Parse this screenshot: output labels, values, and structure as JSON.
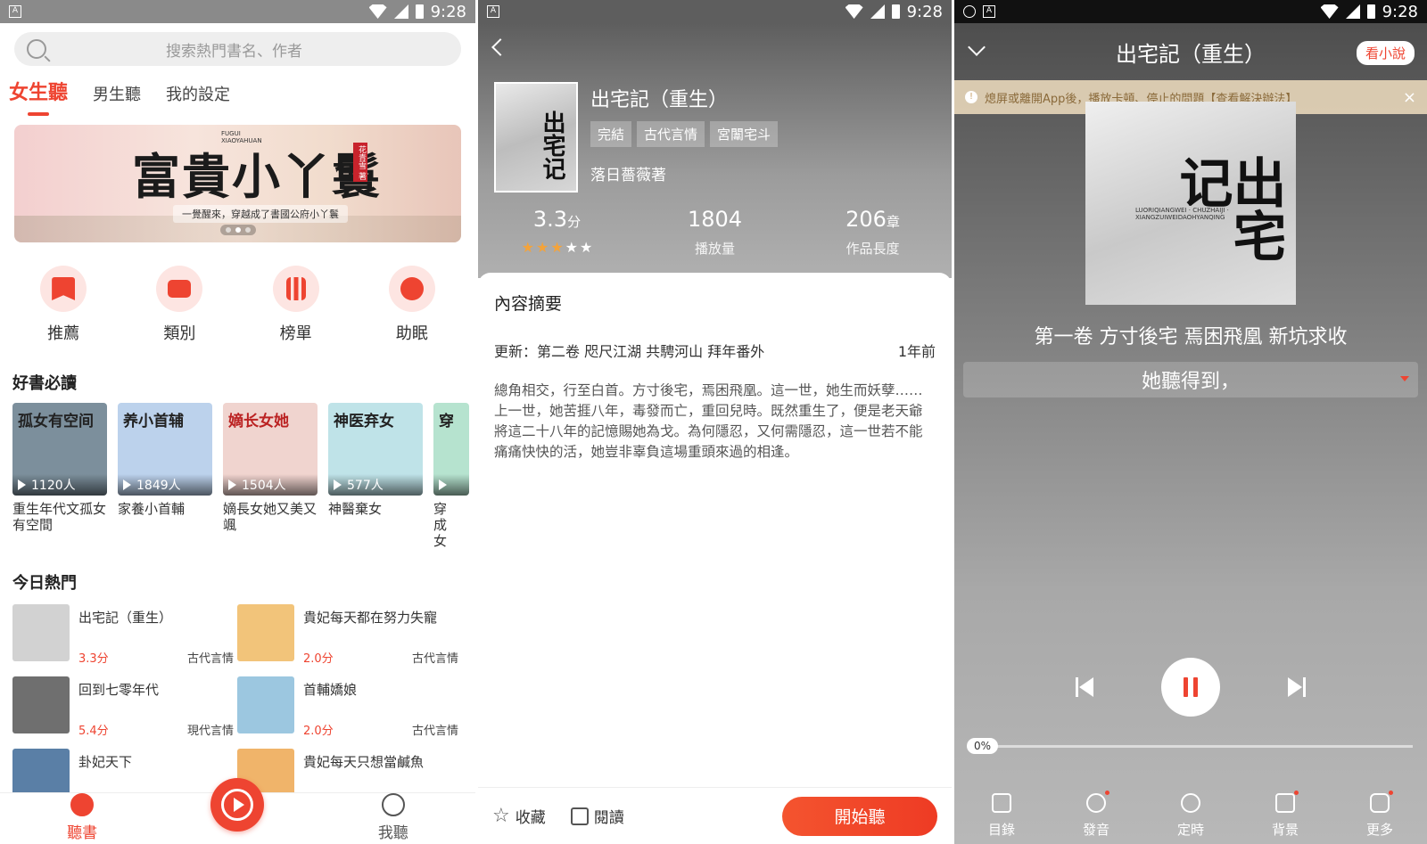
{
  "status": {
    "time": "9:28"
  },
  "home": {
    "search_placeholder": "搜索熱門書名、作者",
    "tabs": [
      "女生聽",
      "男生聽",
      "我的設定"
    ],
    "banner": {
      "title": "富貴小丫鬟",
      "subtitle": "一覺醒來，穿越成了書國公府小丫鬟",
      "seal": "花青雪 著",
      "top_small": "FUGUI XIAOYAHUAN"
    },
    "quick": [
      "推薦",
      "類別",
      "榜單",
      "助眠"
    ],
    "must_read_title": "好書必讀",
    "must_read": [
      {
        "cover_title": "孤女有空间",
        "count": "1120人",
        "name": "重生年代文孤女有空間",
        "bg": "#7c8f9c"
      },
      {
        "cover_title": "养小首辅",
        "count": "1849人",
        "name": "家養小首輔",
        "bg": "#bcd2ec"
      },
      {
        "cover_title": "嫡长女她",
        "count": "1504人",
        "name": "嫡長女她又美又颯",
        "bg": "#f0d4cf"
      },
      {
        "cover_title": "神医弃女",
        "count": "577人",
        "name": "神醫棄女",
        "bg": "#bfe3e8"
      },
      {
        "cover_title": "穿",
        "count": "",
        "name": "穿成女",
        "bg": "#b6e3cf"
      }
    ],
    "hot_title": "今日熱門",
    "hot": [
      {
        "title": "出宅記（重生）",
        "score": "3.3分",
        "cat": "古代言情",
        "bg": "#d2d2d2"
      },
      {
        "title": "貴妃每天都在努力失寵",
        "score": "2.0分",
        "cat": "古代言情",
        "bg": "#f2c47a"
      },
      {
        "title": "回到七零年代",
        "score": "5.4分",
        "cat": "現代言情",
        "bg": "#6f6f6f"
      },
      {
        "title": "首輔嬌娘",
        "score": "2.0分",
        "cat": "古代言情",
        "bg": "#9cc7e0"
      },
      {
        "title": "卦妃天下",
        "score": "",
        "cat": "",
        "bg": "#5a7fa6"
      },
      {
        "title": "貴妃每天只想當鹹魚",
        "score": "",
        "cat": "",
        "bg": "#f0b46a"
      }
    ],
    "nav": [
      "聽書",
      "我聽"
    ]
  },
  "detail": {
    "title": "出宅記（重生）",
    "tags": [
      "完結",
      "古代言情",
      "宮闈宅斗"
    ],
    "author": "落日薔薇著",
    "cover_char": "出宅记",
    "score_value": "3.3",
    "score_unit": "分",
    "rating": 2.5,
    "plays": "1804",
    "plays_label": "播放量",
    "chapters": "206",
    "chapters_unit": "章",
    "chapters_label": "作品長度",
    "summary_title": "內容摘要",
    "update_label": "更新：第二卷 咫尺江湖 共騁河山 拜年番外",
    "update_time": "1年前",
    "summary": "總角相交，行至白首。方寸後宅，焉困飛凰。這一世，她生而妖孽……上一世，她苦捱八年，毒發而亡，重回兒時。既然重生了，便是老天爺將這二十八年的記憶賜她為戈。為何隱忍，又何需隱忍，這一世若不能痛痛快快的活，她豈非辜負這場重頭來過的相逢。",
    "collect": "收藏",
    "read": "閱讀",
    "start": "開始聽"
  },
  "player": {
    "title": "出宅記（重生）",
    "novel_btn": "看小說",
    "notice": "熄屏或離開App後，播放卡頓、停止的問題【查看解決辦法】",
    "cover_char": "出宅记",
    "cover_sub": "LUORIQIANGWEI · CHUZHAIJI · XIANGZUIWEIDAOHYANQING",
    "chapter": "第一卷 方寸後宅 焉困飛凰 新坑求收",
    "lyric": "她聽得到，",
    "progress_label": "0%",
    "progress": 0,
    "tools": [
      "目錄",
      "發音",
      "定時",
      "背景",
      "更多"
    ]
  }
}
